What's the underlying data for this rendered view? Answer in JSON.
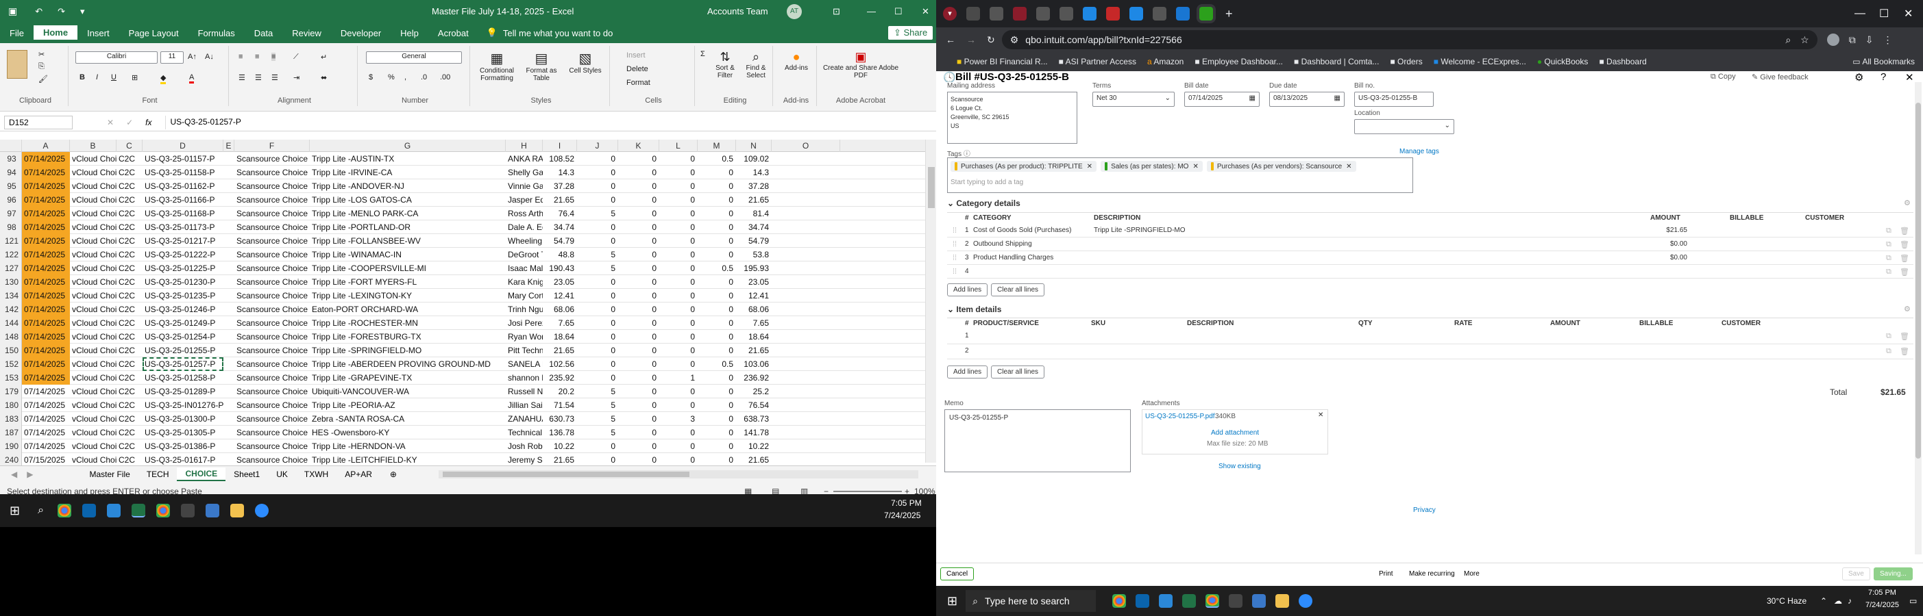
{
  "excel": {
    "title": "Master File July 14-18, 2025  -  Excel",
    "account": "Accounts Team",
    "avatar": "AT",
    "menu": [
      "File",
      "Home",
      "Insert",
      "Page Layout",
      "Formulas",
      "Data",
      "Review",
      "Developer",
      "Help",
      "Acrobat"
    ],
    "tell_me": "Tell me what you want to do",
    "share": "Share",
    "ribbon": {
      "clipboard": "Clipboard",
      "font": "Font",
      "alignment": "Alignment",
      "number": "Number",
      "styles": "Styles",
      "cells": "Cells",
      "editing": "Editing",
      "addins": "Add-ins",
      "adobe": "Adobe Acrobat",
      "font_name": "Calibri",
      "font_size": "11",
      "number_format": "General",
      "cond": "Conditional Formatting",
      "fmt_table": "Format as Table",
      "cell_styles": "Cell Styles",
      "insert": "Insert",
      "delete": "Delete",
      "format": "Format",
      "sort": "Sort & Filter",
      "find": "Find & Select",
      "addins_btn": "Add-ins",
      "share_pdf": "Create and Share Adobe PDF"
    },
    "name_box": "D152",
    "fx": "US-Q3-25-01257-P",
    "columns": [
      "A",
      "B",
      "C",
      "D",
      "E",
      "F",
      "G",
      "H",
      "I",
      "J",
      "K",
      "L",
      "M",
      "N",
      "O"
    ],
    "rows": [
      {
        "n": "93",
        "a": "07/14/2025",
        "b": "vCloud Choice",
        "c": "C2C",
        "d": "US-Q3-25-01157-P",
        "f": "Scansource Choice",
        "g": "Tripp Lite -AUSTIN-TX",
        "h": "ANKA RA",
        "i": "108.52",
        "j": "0",
        "k": "0",
        "l": "0",
        "m": "0.5",
        "n2": "109.02",
        "hl": true
      },
      {
        "n": "94",
        "a": "07/14/2025",
        "b": "vCloud Choice",
        "c": "C2C",
        "d": "US-Q3-25-01158-P",
        "f": "Scansource Choice",
        "g": "Tripp Lite -IRVINE-CA",
        "h": "Shelly Gar",
        "i": "14.3",
        "j": "0",
        "k": "0",
        "l": "0",
        "m": "0",
        "n2": "14.3",
        "hl": true
      },
      {
        "n": "95",
        "a": "07/14/2025",
        "b": "vCloud Choice",
        "c": "C2C",
        "d": "US-Q3-25-01162-P",
        "f": "Scansource Choice",
        "g": "Tripp Lite -ANDOVER-NJ",
        "h": "Vinnie Ga",
        "i": "37.28",
        "j": "0",
        "k": "0",
        "l": "0",
        "m": "0",
        "n2": "37.28",
        "hl": true
      },
      {
        "n": "96",
        "a": "07/14/2025",
        "b": "vCloud Choice",
        "c": "C2C",
        "d": "US-Q3-25-01166-P",
        "f": "Scansource Choice",
        "g": "Tripp Lite -LOS GATOS-CA",
        "h": "Jasper Ed",
        "i": "21.65",
        "j": "0",
        "k": "0",
        "l": "0",
        "m": "0",
        "n2": "21.65",
        "hl": true
      },
      {
        "n": "97",
        "a": "07/14/2025",
        "b": "vCloud Choice",
        "c": "C2C",
        "d": "US-Q3-25-01168-P",
        "f": "Scansource Choice",
        "g": "Tripp Lite -MENLO PARK-CA",
        "h": "Ross Arth",
        "i": "76.4",
        "j": "5",
        "k": "0",
        "l": "0",
        "m": "0",
        "n2": "81.4",
        "hl": true
      },
      {
        "n": "98",
        "a": "07/14/2025",
        "b": "vCloud Choice",
        "c": "C2C",
        "d": "US-Q3-25-01173-P",
        "f": "Scansource Choice",
        "g": "Tripp Lite -PORTLAND-OR",
        "h": "Dale A. Ed",
        "i": "34.74",
        "j": "0",
        "k": "0",
        "l": "0",
        "m": "0",
        "n2": "34.74",
        "hl": true
      },
      {
        "n": "121",
        "a": "07/14/2025",
        "b": "vCloud Choice",
        "c": "C2C",
        "d": "US-Q3-25-01217-P",
        "f": "Scansource Choice",
        "g": "Tripp Lite -FOLLANSBEE-WV",
        "h": "Wheeling",
        "i": "54.79",
        "j": "0",
        "k": "0",
        "l": "0",
        "m": "0",
        "n2": "54.79",
        "hl": true
      },
      {
        "n": "122",
        "a": "07/14/2025",
        "b": "vCloud Choice",
        "c": "C2C",
        "d": "US-Q3-25-01222-P",
        "f": "Scansource Choice",
        "g": "Tripp Lite -WINAMAC-IN",
        "h": "DeGroot T",
        "i": "48.8",
        "j": "5",
        "k": "0",
        "l": "0",
        "m": "0",
        "n2": "53.8",
        "hl": true
      },
      {
        "n": "127",
        "a": "07/14/2025",
        "b": "vCloud Choice",
        "c": "C2C",
        "d": "US-Q3-25-01225-P",
        "f": "Scansource Choice",
        "g": "Tripp Lite -COOPERSVILLE-MI",
        "h": "Isaac Mall",
        "i": "190.43",
        "j": "5",
        "k": "0",
        "l": "0",
        "m": "0.5",
        "n2": "195.93",
        "hl": true
      },
      {
        "n": "130",
        "a": "07/14/2025",
        "b": "vCloud Choice",
        "c": "C2C",
        "d": "US-Q3-25-01230-P",
        "f": "Scansource Choice",
        "g": "Tripp Lite -FORT MYERS-FL",
        "h": "Kara Knigh",
        "i": "23.05",
        "j": "0",
        "k": "0",
        "l": "0",
        "m": "0",
        "n2": "23.05",
        "hl": true
      },
      {
        "n": "134",
        "a": "07/14/2025",
        "b": "vCloud Choice",
        "c": "C2C",
        "d": "US-Q3-25-01235-P",
        "f": "Scansource Choice",
        "g": "Tripp Lite -LEXINGTON-KY",
        "h": "Mary Cort",
        "i": "12.41",
        "j": "0",
        "k": "0",
        "l": "0",
        "m": "0",
        "n2": "12.41",
        "hl": true
      },
      {
        "n": "142",
        "a": "07/14/2025",
        "b": "vCloud Choice",
        "c": "C2C",
        "d": "US-Q3-25-01246-P",
        "f": "Scansource Choice",
        "g": "Eaton-PORT ORCHARD-WA",
        "h": "Trinh Ngu",
        "i": "68.06",
        "j": "0",
        "k": "0",
        "l": "0",
        "m": "0",
        "n2": "68.06",
        "hl": true
      },
      {
        "n": "144",
        "a": "07/14/2025",
        "b": "vCloud Choice",
        "c": "C2C",
        "d": "US-Q3-25-01249-P",
        "f": "Scansource Choice",
        "g": "Tripp Lite -ROCHESTER-MN",
        "h": "Josi Perez",
        "i": "7.65",
        "j": "0",
        "k": "0",
        "l": "0",
        "m": "0",
        "n2": "7.65",
        "hl": true
      },
      {
        "n": "148",
        "a": "07/14/2025",
        "b": "vCloud Choice",
        "c": "C2C",
        "d": "US-Q3-25-01254-P",
        "f": "Scansource Choice",
        "g": "Tripp Lite -FORESTBURG-TX",
        "h": "Ryan Wor",
        "i": "18.64",
        "j": "0",
        "k": "0",
        "l": "0",
        "m": "0",
        "n2": "18.64",
        "hl": true
      },
      {
        "n": "150",
        "a": "07/14/2025",
        "b": "vCloud Choice",
        "c": "C2C",
        "d": "US-Q3-25-01255-P",
        "f": "Scansource Choice",
        "g": "Tripp Lite -SPRINGFIELD-MO",
        "h": "Pitt Techn",
        "i": "21.65",
        "j": "0",
        "k": "0",
        "l": "0",
        "m": "0",
        "n2": "21.65",
        "hl": true
      },
      {
        "n": "152",
        "a": "07/14/2025",
        "b": "vCloud Choice",
        "c": "C2C",
        "d": "US-Q3-25-01257-P",
        "f": "Scansource Choice",
        "g": "Tripp Lite -ABERDEEN PROVING GROUND-MD",
        "h": "SANELA H",
        "i": "102.56",
        "j": "0",
        "k": "0",
        "l": "0",
        "m": "0.5",
        "n2": "103.06",
        "hl": true,
        "sel": true
      },
      {
        "n": "153",
        "a": "07/14/2025",
        "b": "vCloud Choice",
        "c": "C2C",
        "d": "US-Q3-25-01258-P",
        "f": "Scansource Choice",
        "g": "Tripp Lite -GRAPEVINE-TX",
        "h": "shannon h",
        "i": "235.92",
        "j": "0",
        "k": "0",
        "l": "1",
        "m": "0",
        "n2": "236.92",
        "hl": true
      },
      {
        "n": "179",
        "a": "07/14/2025",
        "b": "vCloud Choice",
        "c": "C2C",
        "d": "US-Q3-25-01289-P",
        "f": "Scansource Choice",
        "g": "Ubiquiti-VANCOUVER-WA",
        "h": "Russell Ne",
        "i": "20.2",
        "j": "5",
        "k": "0",
        "l": "0",
        "m": "0",
        "n2": "25.2",
        "hl": false
      },
      {
        "n": "180",
        "a": "07/14/2025",
        "b": "vCloud Choice",
        "c": "C2C",
        "d": "US-Q3-25-IN01276-P",
        "f": "Scansource Choice",
        "g": "Tripp Lite -PEORIA-AZ",
        "h": "Jillian Sai",
        "i": "71.54",
        "j": "5",
        "k": "0",
        "l": "0",
        "m": "0",
        "n2": "76.54",
        "hl": false
      },
      {
        "n": "183",
        "a": "07/14/2025",
        "b": "vCloud Choice",
        "c": "C2C",
        "d": "US-Q3-25-01300-P",
        "f": "Scansource Choice",
        "g": "Zebra -SANTA ROSA-CA",
        "h": "ZANAHUA",
        "i": "630.73",
        "j": "5",
        "k": "0",
        "l": "3",
        "m": "0",
        "n2": "638.73",
        "hl": false
      },
      {
        "n": "187",
        "a": "07/14/2025",
        "b": "vCloud Choice",
        "c": "C2C",
        "d": "US-Q3-25-01305-P",
        "f": "Scansource Choice",
        "g": "HES -Owensboro-KY",
        "h": "Technical",
        "i": "136.78",
        "j": "5",
        "k": "0",
        "l": "0",
        "m": "0",
        "n2": "141.78",
        "hl": false
      },
      {
        "n": "190",
        "a": "07/14/2025",
        "b": "vCloud Choice",
        "c": "C2C",
        "d": "US-Q3-25-01386-P",
        "f": "Scansource Choice",
        "g": "Tripp Lite -HERNDON-VA",
        "h": "Josh Robe",
        "i": "10.22",
        "j": "0",
        "k": "0",
        "l": "0",
        "m": "0",
        "n2": "10.22",
        "hl": false
      },
      {
        "n": "240",
        "a": "07/15/2025",
        "b": "vCloud Choice",
        "c": "C2C",
        "d": "US-Q3-25-01617-P",
        "f": "Scansource Choice",
        "g": "Tripp Lite -LEITCHFIELD-KY",
        "h": "Jeremy Sh",
        "i": "21.65",
        "j": "0",
        "k": "0",
        "l": "0",
        "m": "0",
        "n2": "21.65",
        "hl": false
      }
    ],
    "sheets": [
      "Master File",
      "TECH",
      "CHOICE",
      "Sheet1",
      "UK",
      "TXWH",
      "AP+AR"
    ],
    "active_sheet": "CHOICE",
    "status": "Select destination and press ENTER or choose Paste",
    "zoom": "100%",
    "time": "7:05 PM",
    "date": "7/24/2025"
  },
  "browser": {
    "url": "qbo.intuit.com/app/bill?txnId=227566",
    "bookmarks": [
      "Power BI Financial R...",
      "ASI Partner Access",
      "Amazon",
      "Employee Dashboar...",
      "Dashboard | Comta...",
      "Orders",
      "Welcome - ECExpres...",
      "QuickBooks",
      "Dashboard"
    ],
    "all_bookmarks": "All Bookmarks"
  },
  "qbo": {
    "title": "Bill #US-Q3-25-01255-B",
    "copy": "Copy",
    "feedback": "Give feedback",
    "mailing_label": "Mailing address",
    "mailing": [
      "Scansource",
      "6 Logue Ct.",
      "Greenville, SC 29615",
      "US"
    ],
    "terms_label": "Terms",
    "terms": "Net 30",
    "bill_date_label": "Bill date",
    "bill_date": "07/14/2025",
    "due_date_label": "Due date",
    "due_date": "08/13/2025",
    "bill_no_label": "Bill no.",
    "bill_no": "US-Q3-25-01255-B",
    "location_label": "Location",
    "tags_label": "Tags",
    "manage_tags": "Manage tags",
    "tags": [
      {
        "text": "Purchases (As per product): TRIPPLITE",
        "color": "#f2b705"
      },
      {
        "text": "Sales (as per states): MO",
        "color": "#2ca01c"
      },
      {
        "text": "Purchases (As per vendors): Scansource",
        "color": "#f2b705"
      }
    ],
    "tag_placeholder": "Start typing to add a tag",
    "category_details": "Category details",
    "cat_headers": [
      "#",
      "CATEGORY",
      "DESCRIPTION",
      "AMOUNT",
      "BILLABLE",
      "CUSTOMER"
    ],
    "cat_rows": [
      {
        "n": "1",
        "cat": "Cost of Goods Sold (Purchases)",
        "desc": "Tripp Lite -SPRINGFIELD-MO",
        "amt": "$21.65"
      },
      {
        "n": "2",
        "cat": "Outbound Shipping",
        "desc": "",
        "amt": "$0.00"
      },
      {
        "n": "3",
        "cat": "Product Handling Charges",
        "desc": "",
        "amt": "$0.00"
      },
      {
        "n": "4",
        "cat": "",
        "desc": "",
        "amt": ""
      }
    ],
    "add_lines": "Add lines",
    "clear_lines": "Clear all lines",
    "item_details": "Item details",
    "item_headers": [
      "#",
      "PRODUCT/SERVICE",
      "SKU",
      "DESCRIPTION",
      "QTY",
      "RATE",
      "AMOUNT",
      "BILLABLE",
      "CUSTOMER"
    ],
    "item_rows": [
      "1",
      "2"
    ],
    "total_label": "Total",
    "total": "$21.65",
    "memo_label": "Memo",
    "memo": "US-Q3-25-01255-P",
    "attach_label": "Attachments",
    "attach_file": "US-Q3-25-01255-P.pdf",
    "attach_size": "340KB",
    "add_attach": "Add attachment",
    "max_size": "Max file size: 20 MB",
    "show_existing": "Show existing",
    "privacy": "Privacy",
    "cancel": "Cancel",
    "print": "Print",
    "make_recurring": "Make recurring",
    "more": "More",
    "save": "Save",
    "saving": "Saving..."
  },
  "taskbar": {
    "search": "Type here to search",
    "weather": "30°C  Haze",
    "time": "7:05 PM",
    "date": "7/24/2025"
  }
}
